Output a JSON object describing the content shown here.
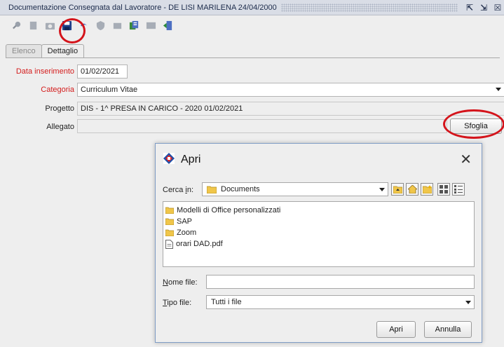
{
  "window": {
    "title": "Documentazione Consegnata dal Lavoratore - DE LISI MARILENA 24/04/2000"
  },
  "tabs": [
    {
      "label": "Elenco",
      "active": false
    },
    {
      "label": "Dettaglio",
      "active": true
    }
  ],
  "form": {
    "data_inserimento": {
      "label": "Data inserimento",
      "value": "01/02/2021"
    },
    "categoria": {
      "label": "Categoria",
      "value": "Curriculum Vitae"
    },
    "progetto": {
      "label": "Progetto",
      "value": "DIS - 1^ PRESA IN CARICO - 2020 01/02/2021"
    },
    "allegato": {
      "label": "Allegato",
      "value": ""
    },
    "sfoglia_label": "Sfoglia"
  },
  "dialog": {
    "title": "Apri",
    "close_glyph": "✕",
    "cerca_label_pre": "Cerca ",
    "cerca_label_key": "i",
    "cerca_label_post": "n:",
    "folder": "Documents",
    "files": [
      {
        "name": "Modelli di Office personalizzati",
        "type": "folder"
      },
      {
        "name": "SAP",
        "type": "folder"
      },
      {
        "name": "Zoom",
        "type": "folder"
      },
      {
        "name": "orari DAD.pdf",
        "type": "file"
      }
    ],
    "nome_file_key": "N",
    "nome_file_rest": "ome file:",
    "nome_file_value": "",
    "tipo_file_key": "T",
    "tipo_file_rest": "ipo file:",
    "tipo_file_value": "Tutti i file",
    "apri_label": "Apri",
    "annulla_label": "Annulla"
  },
  "colors": {
    "required_label": "#d41c1c",
    "annotation_circle": "#d4141b",
    "folder_yellow": "#f0c64a"
  }
}
